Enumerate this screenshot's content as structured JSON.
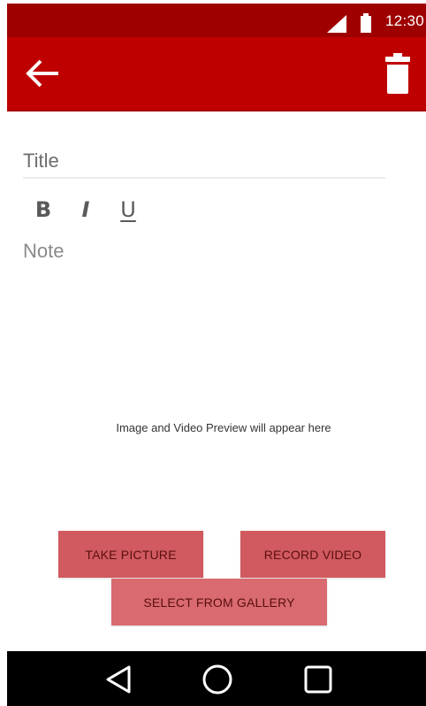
{
  "status_bar": {
    "time": "12:30",
    "signal_icon": "signal-icon",
    "battery_icon": "battery-icon"
  },
  "toolbar": {
    "back_icon": "arrow-left-icon",
    "delete_icon": "trash-icon",
    "background": "#bf0000"
  },
  "editor": {
    "title_placeholder": "Title",
    "title_value": "",
    "format_buttons": {
      "bold": "B",
      "italic": "I",
      "underline": "U"
    },
    "note_placeholder": "Note",
    "note_value": ""
  },
  "preview": {
    "text": "Image and Video Preview will appear here"
  },
  "actions": {
    "take_picture": "TAKE PICTURE",
    "record_video": "RECORD VIDEO",
    "select_from_gallery": "SELECT FROM GALLERY",
    "button_color": "#d05a5f"
  },
  "nav_bar": {
    "back_icon": "nav-back-icon",
    "home_icon": "nav-home-icon",
    "recents_icon": "nav-recents-icon"
  }
}
